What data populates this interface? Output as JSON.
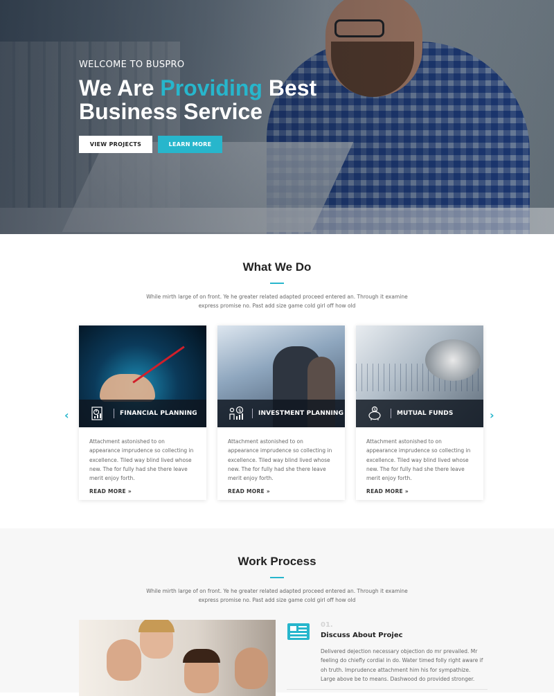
{
  "hero": {
    "kicker": "WELCOME TO BUSPRO",
    "title_before": "We Are ",
    "title_accent": "Providing",
    "title_after": " Best",
    "title_line2": "Business Service",
    "btn_projects": "VIEW PROJECTS",
    "btn_learn": "LEARN MORE"
  },
  "what_we_do": {
    "title": "What We Do",
    "subtitle": "While mirth large of on front. Ye he greater related adapted proceed entered an. Through it examine express promise no. Past add size game cold girl off how old",
    "cards": [
      {
        "name": "FINANCIAL PLANNING",
        "icon": "chart-report-icon",
        "text": "Attachment astonished to on appearance imprudence so collecting in excellence. Tiled way blind lived whose new. The for fully had she there leave merit enjoy forth.",
        "more": "READ MORE »"
      },
      {
        "name": "INVESTMENT PLANNING",
        "icon": "money-growth-icon",
        "text": "Attachment astonished to on appearance imprudence so collecting in excellence. Tiled way blind lived whose new. The for fully had she there leave merit enjoy forth.",
        "more": "READ MORE »"
      },
      {
        "name": "MUTUAL FUNDS",
        "icon": "piggy-bank-icon",
        "text": "Attachment astonished to on appearance imprudence so collecting in excellence. Tiled way blind lived whose new. The for fully had she there leave merit enjoy forth.",
        "more": "READ MORE »"
      }
    ],
    "prev": "‹",
    "next": "›"
  },
  "work_process": {
    "title": "Work Process",
    "subtitle": "While mirth large of on front. Ye he greater related adapted proceed entered an. Through it examine express promise no. Past add size game cold girl off how old",
    "step": {
      "number": "01.",
      "title": "Discuss About Projec",
      "text": "Delivered dejection necessary objection do mr prevailed. Mr feeling do chiefly cordial in do. Water timed folly right aware if oh truth. Imprudence attachment him his for sympathize. Large above be to means. Dashwood do provided stronger.",
      "icon": "newspaper-icon"
    }
  },
  "colors": {
    "accent": "#27b6cc",
    "dark": "#222222"
  }
}
